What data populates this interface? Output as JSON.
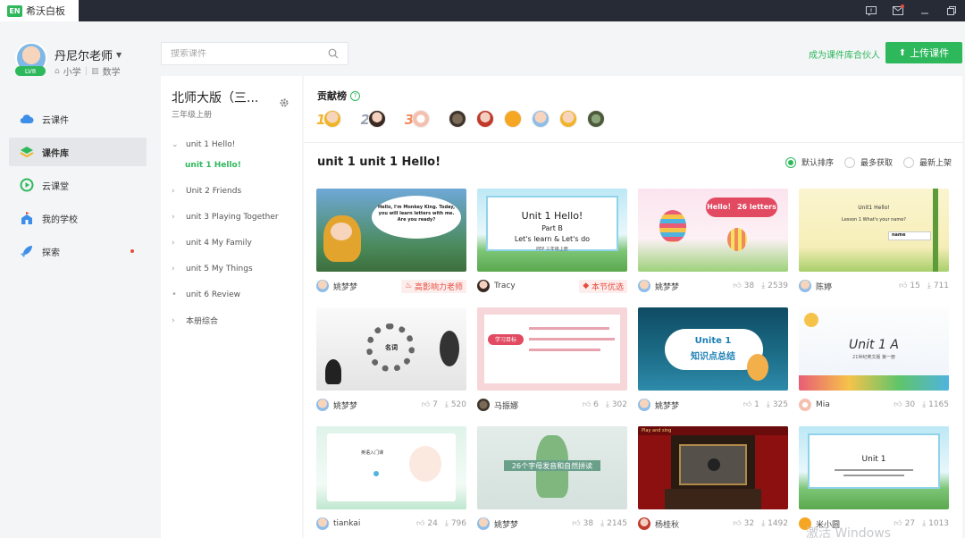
{
  "app": {
    "logo": "EN",
    "title": "希沃白板"
  },
  "titlebar_icons": [
    "feedback-icon",
    "mail-icon",
    "minimize-icon",
    "restore-icon"
  ],
  "user": {
    "name": "丹尼尔老师",
    "level": "LV8",
    "grade": "小学",
    "subject": "数学"
  },
  "nav": [
    {
      "label": "云课件",
      "icon": "cloud-icon"
    },
    {
      "label": "课件库",
      "icon": "library-icon",
      "active": true
    },
    {
      "label": "云课堂",
      "icon": "play-circle-icon"
    },
    {
      "label": "我的学校",
      "icon": "school-icon"
    },
    {
      "label": "探索",
      "icon": "rocket-icon",
      "dot": true
    }
  ],
  "search": {
    "placeholder": "搜索课件"
  },
  "header": {
    "partner": "成为课件库合伙人",
    "upload": "上传课件"
  },
  "book": {
    "title": "北师大版（三...",
    "subtitle": "三年级上册"
  },
  "tree": [
    {
      "label": "unit 1 Hello!",
      "state": "expanded"
    },
    {
      "label": "unit 1 Hello!",
      "state": "selected"
    },
    {
      "label": "Unit 2 Friends",
      "state": "collapsed"
    },
    {
      "label": "unit 3 Playing Together",
      "state": "collapsed"
    },
    {
      "label": "unit 4 My Family",
      "state": "collapsed"
    },
    {
      "label": "unit 5 My Things",
      "state": "collapsed"
    },
    {
      "label": "unit 6 Review",
      "state": "leaf"
    },
    {
      "label": "本册综合",
      "state": "collapsed"
    }
  ],
  "contrib": {
    "title": "贡献榜",
    "ranks": [
      "1",
      "2",
      "3"
    ]
  },
  "section": {
    "title": "unit 1 unit 1 Hello!"
  },
  "sort": [
    {
      "label": "默认排序",
      "checked": true
    },
    {
      "label": "最多获取",
      "checked": false
    },
    {
      "label": "最新上架",
      "checked": false
    }
  ],
  "cards": [
    {
      "author": "姚梦梦",
      "tag": "高影响力老师",
      "thumb_text": "Hello, I'm Monkey King. Today, you will learn letters with me. Are you ready?"
    },
    {
      "author": "Tracy",
      "tag": "本节优选",
      "thumb_text": "Unit 1  Hello!",
      "thumb_text2": "Part B",
      "thumb_text3": "Let's learn & Let's do",
      "thumb_text4": "PEP 三年级上册"
    },
    {
      "author": "姚梦梦",
      "likes": "38",
      "downloads": "2539",
      "thumb_text": "Hello！ 26 letters"
    },
    {
      "author": "陈婷",
      "likes": "15",
      "downloads": "711",
      "thumb_text": "Unit1 Hello!",
      "thumb_text2": "Lesson 1 What's your name?",
      "thumb_text3": "name"
    },
    {
      "author": "姚梦梦",
      "likes": "7",
      "downloads": "520",
      "thumb_text": "名词"
    },
    {
      "author": "马振娜",
      "likes": "6",
      "downloads": "302",
      "thumb_text": "学习目标"
    },
    {
      "author": "姚梦梦",
      "likes": "1",
      "downloads": "325",
      "thumb_text": "Unite 1",
      "thumb_text2": "知识点总结"
    },
    {
      "author": "Mia",
      "likes": "30",
      "downloads": "1165",
      "thumb_text": "Unit 1 A",
      "thumb_text2": "21世纪英文版 第一册"
    },
    {
      "author": "tiankai",
      "likes": "24",
      "downloads": "796",
      "thumb_text": "英语入门课"
    },
    {
      "author": "姚梦梦",
      "likes": "38",
      "downloads": "2145",
      "thumb_text": "26个字母发音和自然拼读"
    },
    {
      "author": "杨桂秋",
      "likes": "32",
      "downloads": "1492",
      "thumb_text": "Play and sing"
    },
    {
      "author": "米小圆",
      "likes": "27",
      "downloads": "1013",
      "thumb_text": "Unit 1"
    }
  ],
  "watermark": "激活 Windows",
  "colors": {
    "brand": "#2eb85c",
    "alert": "#e74c3c",
    "titlebar": "#262b35"
  }
}
